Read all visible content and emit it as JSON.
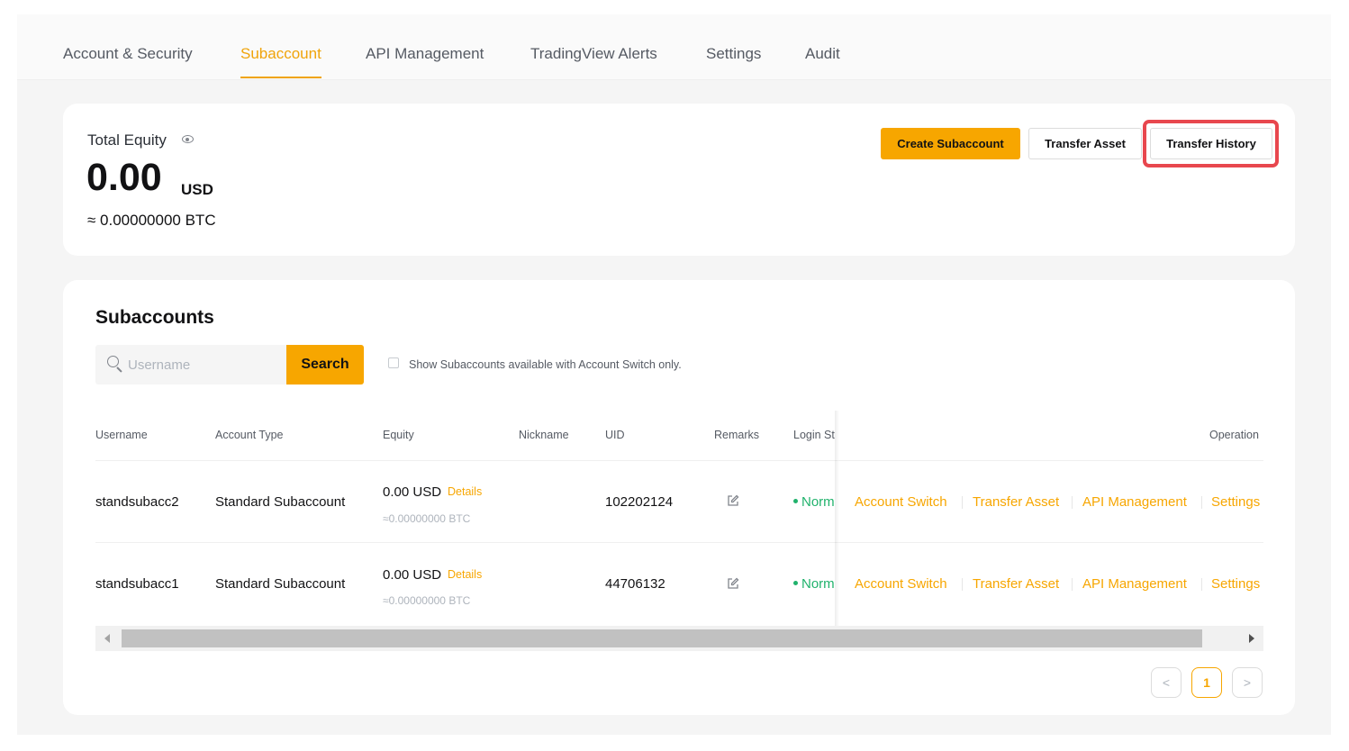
{
  "tabs": [
    {
      "label": "Account & Security"
    },
    {
      "label": "Subaccount",
      "active": true
    },
    {
      "label": "API Management"
    },
    {
      "label": "TradingView Alerts"
    },
    {
      "label": "Settings"
    },
    {
      "label": "Audit"
    }
  ],
  "equity": {
    "label": "Total Equity",
    "value": "0.00",
    "unit": "USD",
    "btc": "≈ 0.00000000 BTC",
    "icon": "eye-icon"
  },
  "actions": {
    "create": "Create Subaccount",
    "transfer": "Transfer Asset",
    "history": "Transfer History"
  },
  "subaccounts": {
    "title": "Subaccounts",
    "search_placeholder": "Username",
    "search_button": "Search",
    "filter_label": "Show Subaccounts available with Account Switch only.",
    "columns": [
      "Username",
      "Account Type",
      "Equity",
      "Nickname",
      "UID",
      "Remarks",
      "Login St",
      "Operation"
    ],
    "rows": [
      {
        "username": "standsubacc2",
        "type": "Standard Subaccount",
        "equity": "0.00 USD",
        "details": "Details",
        "btc": "≈0.00000000 BTC",
        "uid": "102202124",
        "status": "Norm",
        "ops": [
          "Account Switch",
          "Transfer Asset",
          "API Management",
          "Settings"
        ]
      },
      {
        "username": "standsubacc1",
        "type": "Standard Subaccount",
        "equity": "0.00 USD",
        "details": "Details",
        "btc": "≈0.00000000 BTC",
        "uid": "44706132",
        "status": "Norm",
        "ops": [
          "Account Switch",
          "Transfer Asset",
          "API Management",
          "Settings"
        ]
      }
    ]
  },
  "pagination": {
    "prev": "<",
    "current": "1",
    "next": ">"
  },
  "colors": {
    "accent": "#f7a600",
    "status_ok": "#20b26c",
    "highlight": "#e8474e"
  }
}
